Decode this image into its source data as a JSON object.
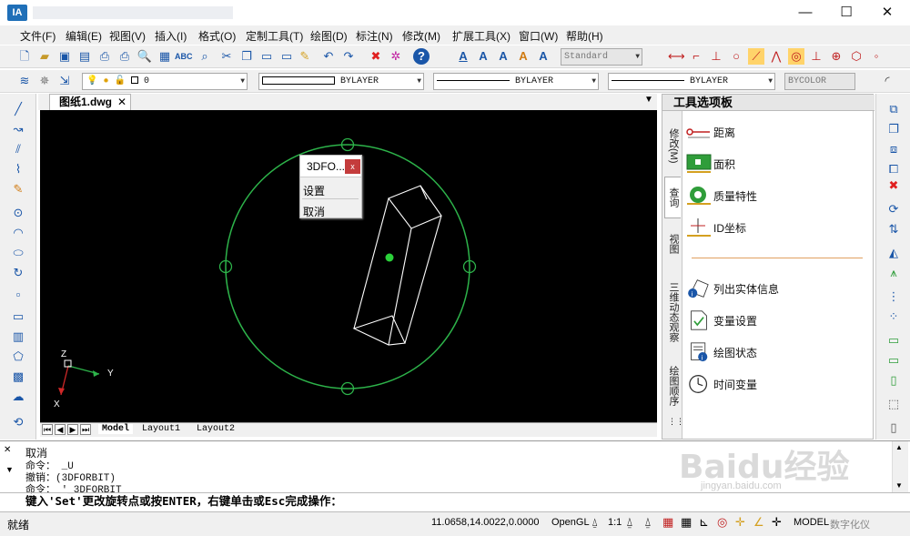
{
  "app": {
    "icon_label": "IA",
    "title": "",
    "window_buttons": {
      "minimize": "—",
      "maximize": "☐",
      "close": "✕"
    }
  },
  "menu": [
    "文件(F)",
    "编辑(E)",
    "视图(V)",
    "插入(I)",
    "格式(O)",
    "定制工具(T)",
    "绘图(D)",
    "标注(N)",
    "修改(M)",
    "扩展工具(X)",
    "窗口(W)",
    "帮助(H)"
  ],
  "toolbar1": {
    "text_style": "Standard"
  },
  "toolbar2": {
    "layer_value": "0",
    "color": "BYLAYER",
    "linetype": "BYLAYER",
    "lineweight": "BYLAYER",
    "plot_style": "BYCOLOR"
  },
  "document": {
    "tab": "图纸1.dwg"
  },
  "context_menu": {
    "title": "3DFO...",
    "items": [
      "设置",
      "取消"
    ]
  },
  "ucs": {
    "z": "Z",
    "y": "Y",
    "x": "X"
  },
  "layouts": [
    "Model",
    "Layout1",
    "Layout2"
  ],
  "palette": {
    "title": "工具选项板",
    "tabs": [
      "修改(M)",
      "查询",
      "视图",
      "三维动态观察",
      "绘图顺序"
    ],
    "items": [
      "距离",
      "面积",
      "质量特性",
      "ID坐标",
      "列出实体信息",
      "变量设置",
      "绘图状态",
      "时间变量"
    ]
  },
  "command": {
    "history": [
      "取消",
      "命令： _U",
      "撤销：(3DFORBIT)",
      "命令： '_3DFORBIT"
    ],
    "prompt": "键入'Set'更改旋转点或按ENTER，右键单击或Esc完成操作："
  },
  "status": {
    "left": "就绪",
    "coords": "11.0658,14.0022,0.0000",
    "opengl": "OpenGL",
    "scale": "1:1",
    "model": "MODEL",
    "digitize": "数字化仪"
  },
  "watermark": {
    "brand": "Baidu经验",
    "url": "jingyan.baidu.com"
  },
  "colors": {
    "canvas": "#000000",
    "orbit": "#2db34a",
    "wire": "#ffffff",
    "accent": "#1a56a8"
  }
}
